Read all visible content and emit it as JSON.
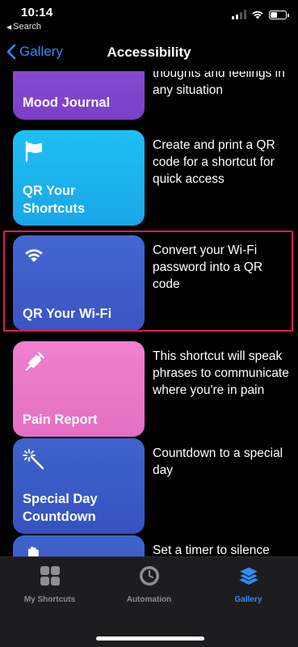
{
  "status": {
    "time": "10:14",
    "back_app": "Search"
  },
  "nav": {
    "back_label": "Gallery",
    "title": "Accessibility"
  },
  "shortcuts": [
    {
      "name": "Mood Journal",
      "description": "thoughts and feelings in any situation",
      "icon": "none",
      "color": "#8c55d8"
    },
    {
      "name": "QR Your Shortcuts",
      "description": "Create and print a QR code for a shortcut for quick access",
      "icon": "flag-icon",
      "color": "#1ec0f2"
    },
    {
      "name": "QR Your Wi-Fi",
      "description": "Convert your Wi-Fi password into a QR code",
      "icon": "wifi-icon",
      "color": "#4466cf"
    },
    {
      "name": "Pain Report",
      "description": "This shortcut will speak phrases to communicate where you're in pain",
      "icon": "syringe-icon",
      "color": "#ef82cf"
    },
    {
      "name": "Special Day Countdown",
      "description": "Countdown to a special day",
      "icon": "magic-wand-icon",
      "color": "#3f63cc"
    },
    {
      "name": "",
      "description": "Set a timer to silence notifications and help you concentrate",
      "icon": "hand-icon",
      "color": "#3f63cc"
    }
  ],
  "tabs": [
    {
      "label": "My Shortcuts",
      "icon": "grid-icon",
      "active": false
    },
    {
      "label": "Automation",
      "icon": "clock-icon",
      "active": false
    },
    {
      "label": "Gallery",
      "icon": "layers-icon",
      "active": true
    }
  ],
  "colors": {
    "accent": "#2f8cff",
    "highlight": "#e01d4c",
    "tab_inactive": "#8e8e93"
  }
}
